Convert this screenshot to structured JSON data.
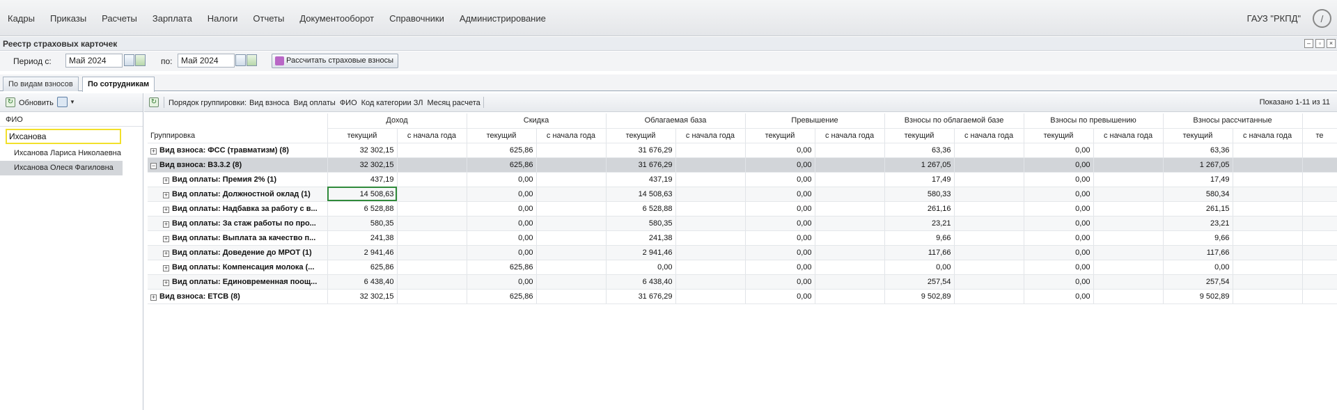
{
  "menu": [
    "Кадры",
    "Приказы",
    "Расчеты",
    "Зарплата",
    "Налоги",
    "Отчеты",
    "Документооборот",
    "Справочники",
    "Администрирование"
  ],
  "org": "ГАУЗ \"РКПД\"",
  "window_title": "Реестр страховых карточек",
  "period": {
    "from_label": "Период с:",
    "from_value": "Май 2024",
    "to_label": "по:",
    "to_value": "Май 2024",
    "calc_button": "Рассчитать страховые взносы"
  },
  "tabs": [
    "По видам взносов",
    "По сотрудникам"
  ],
  "left": {
    "refresh": "Обновить",
    "column": "ФИО",
    "search_value": "Ихсанова",
    "employees": [
      "Ихсанова Лариса Николаевна",
      "Ихсанова Олеся Фагиловна"
    ]
  },
  "grid_toolbar": {
    "grouping_label": "Порядок группировки:",
    "grouping_items": [
      "Вид взноса",
      "Вид оплаты",
      "ФИО",
      "Код категории ЗЛ",
      "Месяц расчета"
    ],
    "shown": "Показано 1-11 из 11"
  },
  "columns": {
    "grouping": "Группировка",
    "groups": [
      "Доход",
      "Скидка",
      "Облагаемая база",
      "Превышение",
      "Взносы по облагаемой базе",
      "Взносы по превышению",
      "Взносы рассчитанные",
      ""
    ],
    "sub_current": "текущий",
    "sub_ytd": "с начала года",
    "last_sub": "те"
  },
  "rows": [
    {
      "name": "Вид взноса: ФСС (травматизм) (8)",
      "exp": "+",
      "level": 1,
      "vals": [
        "32 302,15",
        "625,86",
        "31 676,29",
        "0,00",
        "63,36",
        "0,00",
        "63,36"
      ]
    },
    {
      "name": "Вид взноса: В3.3.2 (8)",
      "exp": "−",
      "level": 1,
      "vals": [
        "32 302,15",
        "625,86",
        "31 676,29",
        "0,00",
        "1 267,05",
        "0,00",
        "1 267,05"
      ]
    },
    {
      "name": "Вид оплаты: Премия 2% (1)",
      "exp": "+",
      "level": 2,
      "vals": [
        "437,19",
        "0,00",
        "437,19",
        "0,00",
        "17,49",
        "0,00",
        "17,49"
      ]
    },
    {
      "name": "Вид оплаты: Должностной оклад (1)",
      "exp": "+",
      "level": 2,
      "vals": [
        "14 508,63",
        "0,00",
        "14 508,63",
        "0,00",
        "580,33",
        "0,00",
        "580,34"
      ]
    },
    {
      "name": "Вид оплаты: Надбавка за работу с в...",
      "exp": "+",
      "level": 2,
      "vals": [
        "6 528,88",
        "0,00",
        "6 528,88",
        "0,00",
        "261,16",
        "0,00",
        "261,15"
      ]
    },
    {
      "name": "Вид оплаты: За стаж работы по про...",
      "exp": "+",
      "level": 2,
      "vals": [
        "580,35",
        "0,00",
        "580,35",
        "0,00",
        "23,21",
        "0,00",
        "23,21"
      ]
    },
    {
      "name": "Вид оплаты: Выплата за качество п...",
      "exp": "+",
      "level": 2,
      "vals": [
        "241,38",
        "0,00",
        "241,38",
        "0,00",
        "9,66",
        "0,00",
        "9,66"
      ]
    },
    {
      "name": "Вид оплаты: Доведение до МРОТ (1)",
      "exp": "+",
      "level": 2,
      "vals": [
        "2 941,46",
        "0,00",
        "2 941,46",
        "0,00",
        "117,66",
        "0,00",
        "117,66"
      ]
    },
    {
      "name": "Вид оплаты: Компенсация молока (...",
      "exp": "+",
      "level": 2,
      "vals": [
        "625,86",
        "625,86",
        "0,00",
        "0,00",
        "0,00",
        "0,00",
        "0,00"
      ]
    },
    {
      "name": "Вид оплаты: Единовременная поощ...",
      "exp": "+",
      "level": 2,
      "vals": [
        "6 438,40",
        "0,00",
        "6 438,40",
        "0,00",
        "257,54",
        "0,00",
        "257,54"
      ]
    },
    {
      "name": "Вид взноса: ЕТСВ (8)",
      "exp": "+",
      "level": 1,
      "vals": [
        "32 302,15",
        "625,86",
        "31 676,29",
        "0,00",
        "9 502,89",
        "0,00",
        "9 502,89"
      ]
    }
  ]
}
